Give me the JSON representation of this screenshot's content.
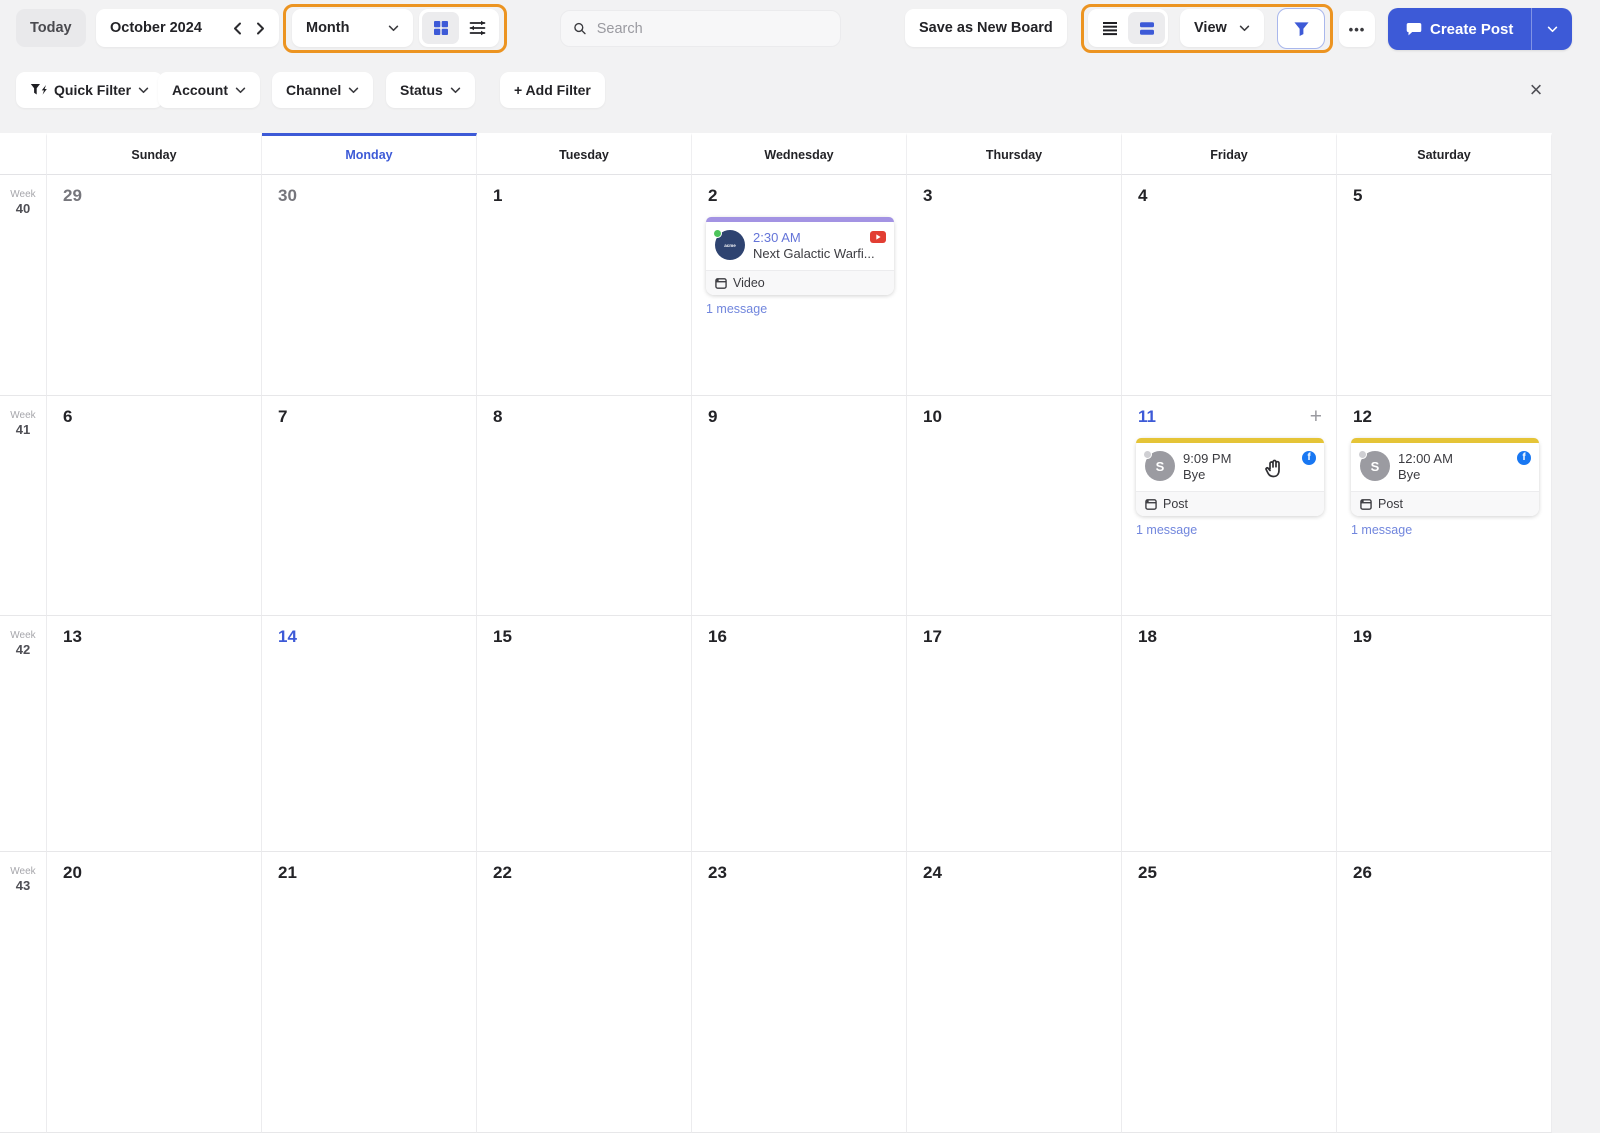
{
  "toolbar": {
    "today_label": "Today",
    "month_label": "October 2024",
    "view_mode_label": "Month",
    "search_placeholder": "Search",
    "save_board_label": "Save as New Board",
    "view_label": "View",
    "more_label": "•••",
    "create_post_label": "Create Post",
    "accent_color": "#3D5AD7",
    "highlight_color": "#EC9421"
  },
  "filter_bar": {
    "quick_filter_label": "Quick Filter",
    "account_label": "Account",
    "channel_label": "Channel",
    "status_label": "Status",
    "add_filter_label": "+ Add Filter",
    "close_label": "×"
  },
  "icons": {
    "facebook_glyph": "f",
    "grid": "grid-2x2",
    "sliders": "adjustments",
    "list": "list-rows",
    "cards": "card-rows",
    "funnel": "filter-funnel",
    "search": "magnifier",
    "create_post": "flag-bubble",
    "hand": "grab-cursor"
  },
  "calendar": {
    "week_label": "Week",
    "add_label": "+",
    "day_headers": [
      {
        "label": "Sunday",
        "active": false
      },
      {
        "label": "Monday",
        "active": true
      },
      {
        "label": "Tuesday",
        "active": false
      },
      {
        "label": "Wednesday",
        "active": false
      },
      {
        "label": "Thursday",
        "active": false
      },
      {
        "label": "Friday",
        "active": false
      },
      {
        "label": "Saturday",
        "active": false
      }
    ],
    "events": [
      {
        "time": "2:30 AM",
        "time_color": "#6474D8",
        "title": "Next Galactic Warfi...",
        "network": "youtube",
        "accent_color": "#A393E3",
        "type_label": "Video",
        "messages_label": "1 message",
        "avatar": {
          "label": "acme",
          "bg": "#2E4370",
          "dot_color": "#4DC45B",
          "logo": true
        }
      },
      {
        "time": "9:09 PM",
        "time_color": "#3C3C41",
        "title": "Bye",
        "network": "facebook",
        "accent_color": "#E5C437",
        "type_label": "Post",
        "messages_label": "1 message",
        "cursor": true,
        "avatar": {
          "label": "S",
          "bg": "#9B9BA1",
          "dot_color": "#CFCFD3"
        }
      },
      {
        "time": "12:00 AM",
        "time_color": "#3C3C41",
        "title": "Bye",
        "network": "facebook",
        "accent_color": "#E5C437",
        "type_label": "Post",
        "messages_label": "1 message",
        "avatar": {
          "label": "S",
          "bg": "#9B9BA1",
          "dot_color": "#CFCFD3"
        }
      }
    ],
    "weeks": [
      {
        "number": "40",
        "days": [
          {
            "date": "29",
            "outside": true
          },
          {
            "date": "30",
            "outside": true
          },
          {
            "date": "1"
          },
          {
            "date": "2",
            "event": 0
          },
          {
            "date": "3"
          },
          {
            "date": "4"
          },
          {
            "date": "5"
          }
        ]
      },
      {
        "number": "41",
        "days": [
          {
            "date": "6"
          },
          {
            "date": "7"
          },
          {
            "date": "8"
          },
          {
            "date": "9"
          },
          {
            "date": "10"
          },
          {
            "date": "11",
            "highlight": true,
            "add_button": true,
            "event": 1
          },
          {
            "date": "12",
            "event": 2
          }
        ]
      },
      {
        "number": "42",
        "days": [
          {
            "date": "13"
          },
          {
            "date": "14",
            "highlight": true
          },
          {
            "date": "15"
          },
          {
            "date": "16"
          },
          {
            "date": "17"
          },
          {
            "date": "18"
          },
          {
            "date": "19"
          }
        ]
      },
      {
        "number": "43",
        "days": [
          {
            "date": "20"
          },
          {
            "date": "21"
          },
          {
            "date": "22"
          },
          {
            "date": "23"
          },
          {
            "date": "24"
          },
          {
            "date": "25"
          },
          {
            "date": "26"
          }
        ]
      }
    ]
  }
}
